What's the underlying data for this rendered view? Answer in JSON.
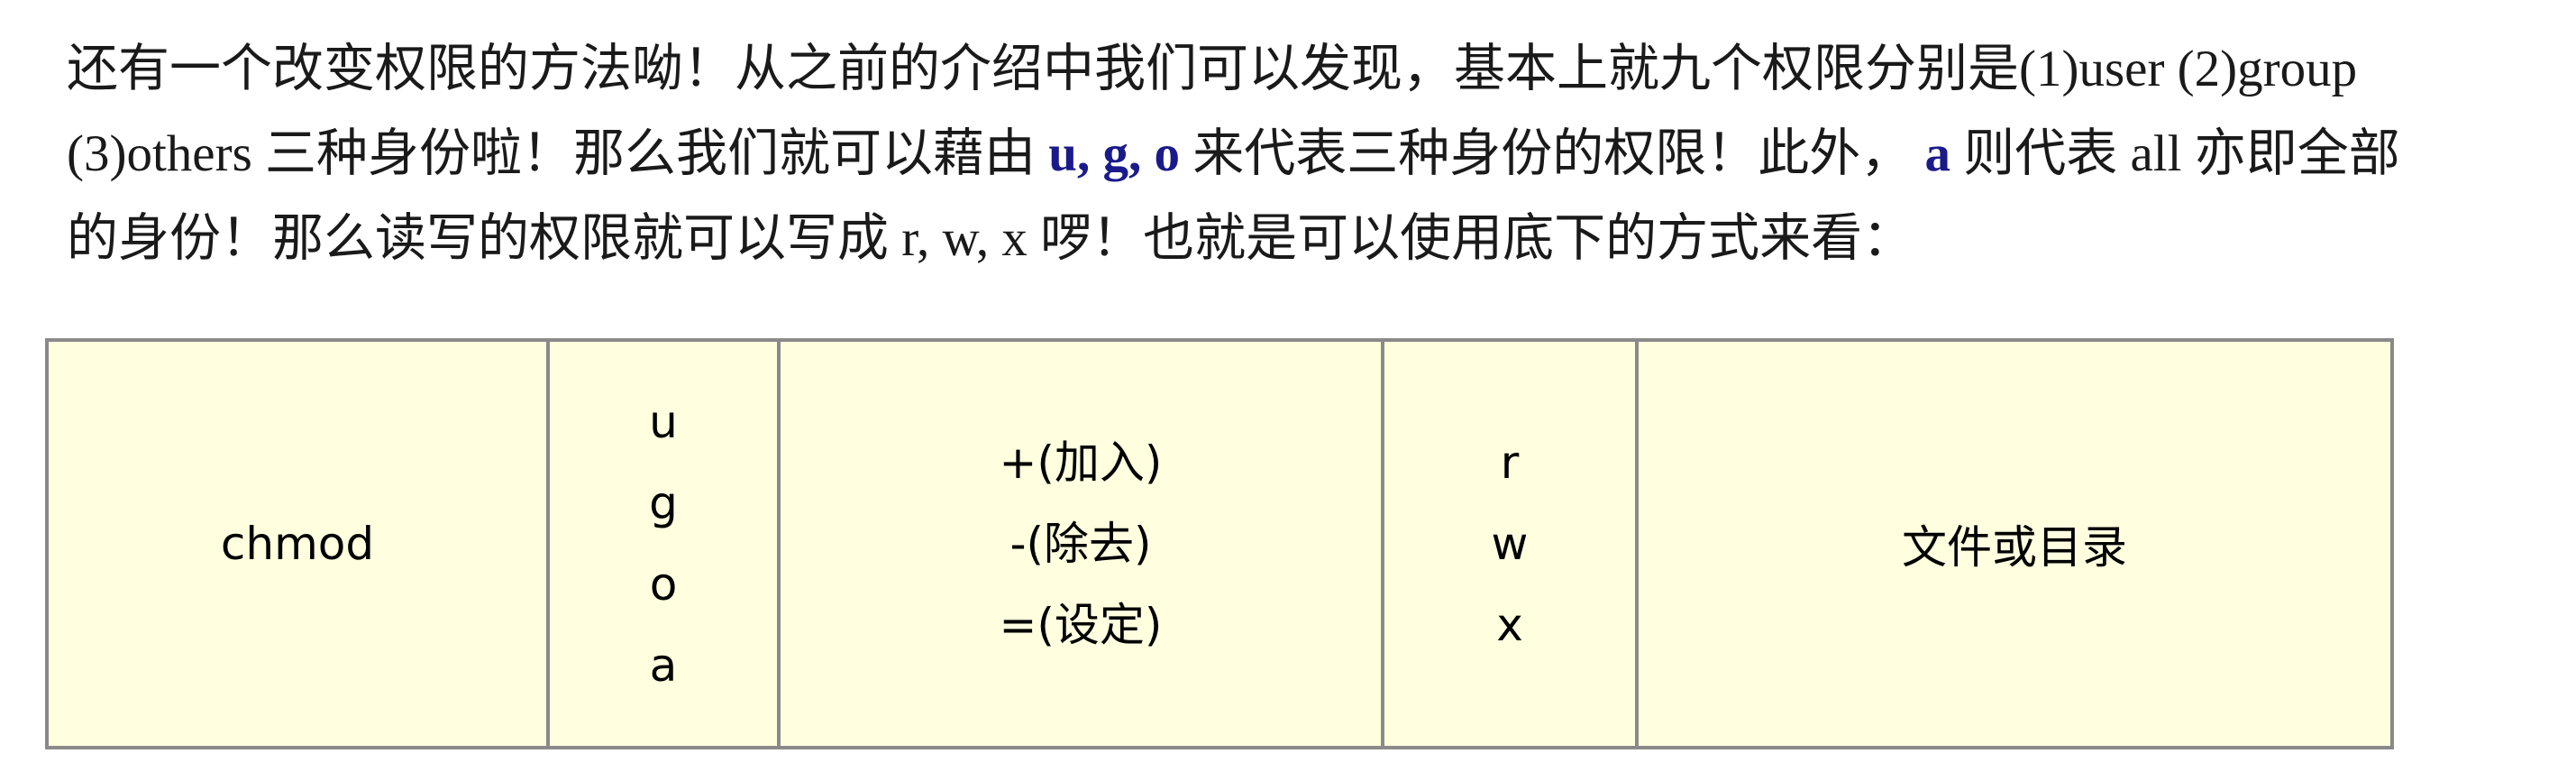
{
  "paragraph": {
    "line1": "还有一个改变权限的方法呦！从之前的介绍中我们可以发现，基本上就九个权限分别是(1)user (2)group",
    "line2_pre": "(3)others 三种身份啦！那么我们就可以藉由 ",
    "line2_em1": "u, g, o",
    "line2_mid": " 来代表三种身份的权限！此外， ",
    "line2_em2": "a",
    "line2_post": " 则代表  all  亦即全部",
    "line3": "的身份！那么读写的权限就可以写成 r, w, x 啰！也就是可以使用底下的方式来看："
  },
  "table": {
    "command": "chmod",
    "identities": [
      "u",
      "g",
      "o",
      "a"
    ],
    "operators": [
      "+(加入)",
      "-(除去)",
      "=(设定)"
    ],
    "permissions": [
      "r",
      "w",
      "x"
    ],
    "target": "文件或目录"
  },
  "colors": {
    "table_background": "#ffffe0",
    "border": "#8a8a8a",
    "emphasis": "#1b1a8a"
  }
}
